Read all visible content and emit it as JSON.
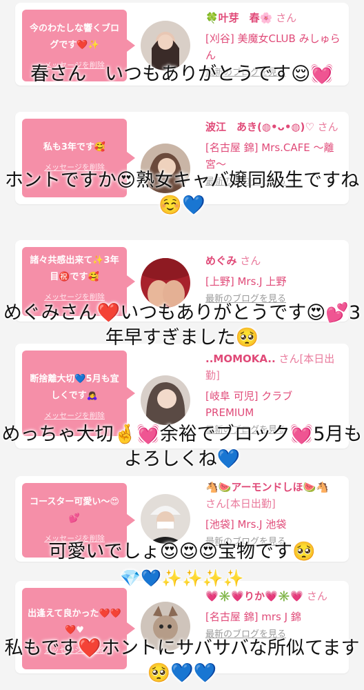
{
  "colors": {
    "bubble_bg": "#f58fa8",
    "name_color": "#e04a78",
    "link_gray": "#9a9a9a",
    "page_bg": "#f4f4f4"
  },
  "cards": [
    {
      "bubble_text": "今のわたしな響くブログです❤️✨",
      "delete_label": "メッセージを削除",
      "name": "🍀叶芽　春🌸",
      "san": "さん",
      "shop": "[刈谷] 美魔女CLUB みしゅらん",
      "blog_link": "最新のブログを見る",
      "avatar_tone": "#3a2b28",
      "overlay_text": "春さん　いつもありがとうです😌💓"
    },
    {
      "bubble_text": "私も3年です🥰",
      "delete_label": "メッセージを削除",
      "name": "波江　あき(◍•ᴗ•◍)♡",
      "san": "さん",
      "shop": "[名古屋 錦] Mrs.CAFE ～離宮～",
      "blog_link": "最新のブログを見る",
      "avatar_tone": "#6b4a3b",
      "overlay_text": "ホントですか😍熟女キャバ嬢同級生ですね☺️💙"
    },
    {
      "bubble_text": "諸々共感出来て✨3年目㊗️です🥰",
      "delete_label": "メッセージを削除",
      "name": "めぐみ",
      "san": "さん",
      "shop": "[上野] Mrs.J 上野",
      "blog_link": "最新のブログを見る",
      "avatar_tone": "#8e1a22",
      "overlay_text": "めぐみさん❤️いつもありがとうです😍💕3年早すぎました🥺"
    },
    {
      "bubble_text": "断捨離大切💙5月も宜しくです🙇‍♀️",
      "delete_label": "メッセージを削除",
      "name": "..MOMOKA..",
      "san": "さん[本日出勤]",
      "shop": "[岐阜 可児] クラブ PREMIUM",
      "blog_link": "最新のブログを見る",
      "avatar_tone": "#5a4a44",
      "overlay_text": "めっちゃ大切🤞💓余裕でブロック💓5月もよろしくね💙"
    },
    {
      "bubble_text": "コースター可愛い～😍💕",
      "delete_label": "メッセージを削除",
      "name": "🐴🍉アーモンドしほ🍉🐴",
      "san": "さん[本日出勤]",
      "shop": "[池袋] Mrs.J 池袋",
      "blog_link": "最新のブログを見る",
      "avatar_tone": "#c9c2ba",
      "overlay_text": "可愛いでしょ😍😍😍宝物です🥺"
    },
    {
      "bubble_text": "出逢えて良かった❤️❤️❤️♥",
      "delete_label": "メッセージを削除",
      "name": "💗✳️💗りか💗✳️💗",
      "san": "さん",
      "shop": "[名古屋 錦] mrs J 錦",
      "blog_link": "最新のブログを見る",
      "avatar_tone": "#b59c88",
      "overlay_text": "私もです❤️ホントにサバサバな所似てます🥺💙💙"
    }
  ],
  "decor_line": "💎💙✨✨✨✨"
}
